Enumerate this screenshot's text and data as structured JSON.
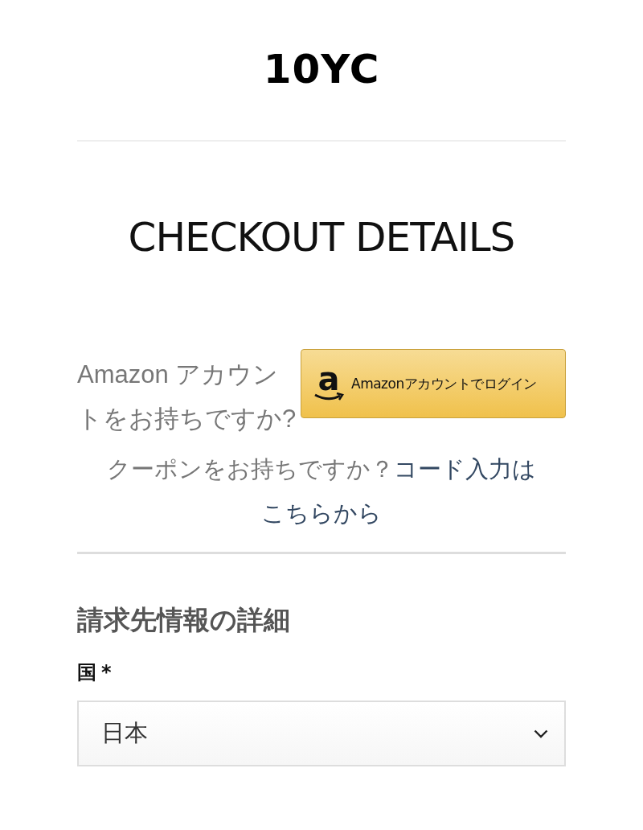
{
  "logo": "10YC",
  "page_title": "CHECKOUT DETAILS",
  "amazon": {
    "prompt": "Amazon アカウントをお持ちですか?",
    "button": {
      "logo_letter": "a",
      "label": "Amazonアカウントでログイン"
    }
  },
  "coupon": {
    "prompt": "クーポンをお持ちですか？",
    "link_lines": [
      "コード入力は",
      "こちらから"
    ]
  },
  "billing": {
    "heading": "請求先情報の詳細",
    "fields": [
      {
        "kind": "select",
        "label": "国",
        "required_mark": "*",
        "value": "日本"
      }
    ]
  }
}
